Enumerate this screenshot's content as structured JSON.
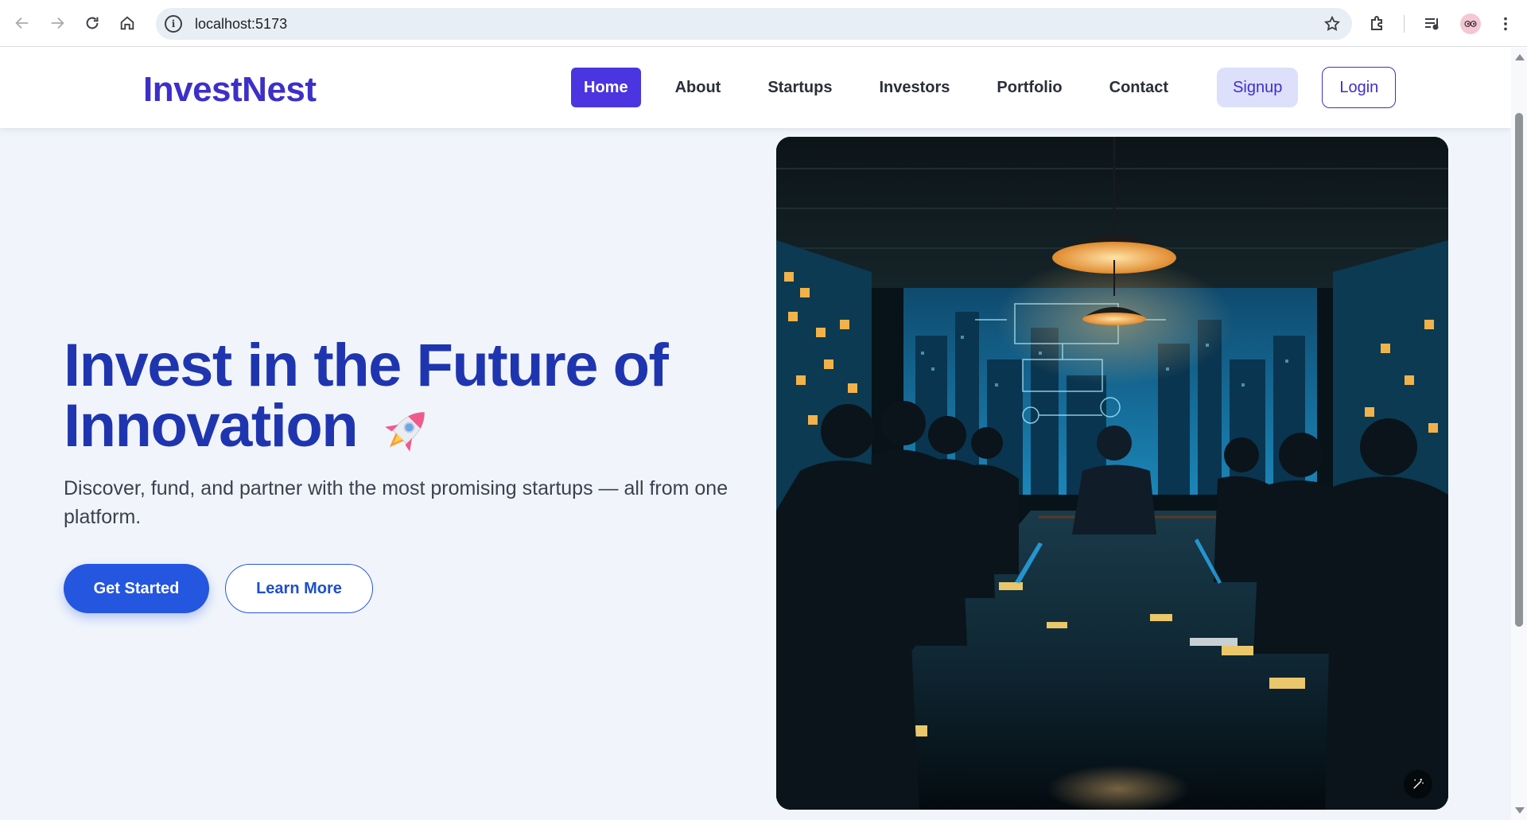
{
  "browser": {
    "url": "localhost:5173",
    "icons": {
      "back": "back-arrow-icon",
      "forward": "forward-arrow-icon",
      "reload": "reload-icon",
      "home": "home-icon",
      "site_info": "info-icon",
      "bookmark": "star-icon",
      "extensions": "puzzle-icon",
      "media": "media-controls-icon",
      "profile": "profile-avatar",
      "menu": "kebab-menu-icon"
    }
  },
  "site": {
    "logo": "InvestNest",
    "nav": [
      {
        "label": "Home",
        "active": true
      },
      {
        "label": "About",
        "active": false
      },
      {
        "label": "Startups",
        "active": false
      },
      {
        "label": "Investors",
        "active": false
      },
      {
        "label": "Portfolio",
        "active": false
      },
      {
        "label": "Contact",
        "active": false
      }
    ],
    "signup_label": "Signup",
    "login_label": "Login"
  },
  "hero": {
    "title_line1": "Invest in the Future of",
    "title_line2": "Innovation",
    "title_emoji": "rocket-icon",
    "subtitle": "Discover, fund, and partner with the most promising startups — all from one platform.",
    "primary_button": "Get Started",
    "secondary_button": "Learn More",
    "image_alt": "team meeting in a night-time office boardroom",
    "image_badge_icon": "magic-wand-icon"
  },
  "colors": {
    "brand": "#3d2fc9",
    "hero_title": "#1f35b0",
    "primary_button": "#2456e0",
    "page_background": "#f1f5fb"
  }
}
